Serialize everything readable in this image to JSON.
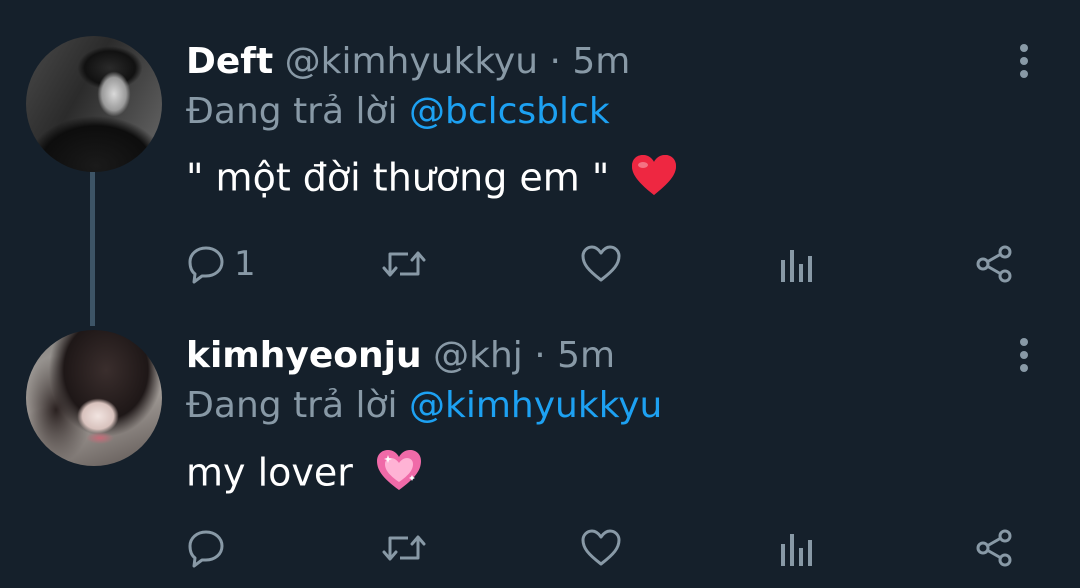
{
  "tweets": [
    {
      "name": "Deft",
      "handle": "@kimhyukkyu",
      "separator": "·",
      "time": "5m",
      "reply_prefix": "Đang trả lời",
      "reply_to": "@bclcsblck",
      "text": "\" một đời thương em \"",
      "emoji": "red-heart",
      "reply_count": "1",
      "avatar": "grayscale portrait photo"
    },
    {
      "name": "kimhyeonju",
      "handle": "@khj",
      "separator": "·",
      "time": "5m",
      "reply_prefix": "Đang trả lời",
      "reply_to": "@kimhyukkyu",
      "text": "my lover",
      "emoji": "sparkling-heart",
      "reply_count": "",
      "avatar": "selfie portrait photo"
    }
  ],
  "icons": {
    "reply": "speech-bubble-icon",
    "retweet": "retweet-icon",
    "like": "heart-icon",
    "stats": "bar-chart-icon",
    "share": "share-icon",
    "more": "vertical-dots-icon"
  },
  "colors": {
    "background": "#15202b",
    "secondary_text": "#8899a6",
    "mention": "#1da1f2",
    "thread_line": "#3d5466",
    "icon": "#8899a6"
  }
}
